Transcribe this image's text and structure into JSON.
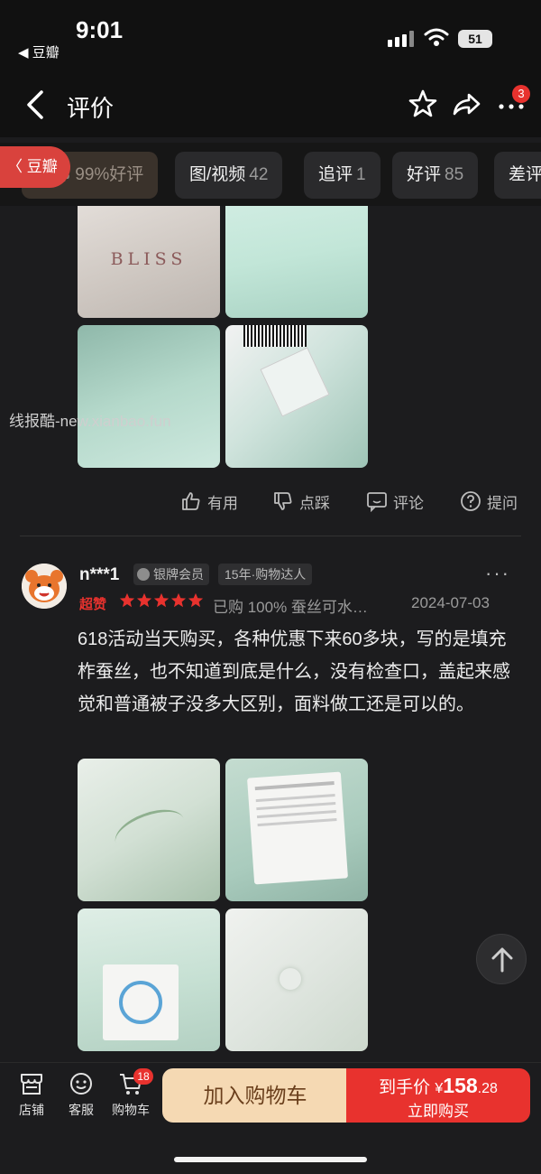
{
  "status": {
    "time": "9:01",
    "back_app": "◀ 豆瓣",
    "battery": "51"
  },
  "navbar": {
    "title": "评价",
    "more_badge": "3"
  },
  "floating_back": "〈 豆瓣",
  "tabs": [
    {
      "label": "全部 99%好评",
      "count": ""
    },
    {
      "label": "图/视频",
      "count": "42"
    },
    {
      "label": "追评",
      "count": "1"
    },
    {
      "label": "好评",
      "count": "85"
    },
    {
      "label": "差评",
      "count": ""
    }
  ],
  "first_review": {
    "image_texts": {
      "bliss": "BLISS"
    },
    "watermark": "线报酷-new.xianbao.fun",
    "actions": {
      "useful": "有用",
      "dislike": "点踩",
      "comment": "评论",
      "ask": "提问"
    }
  },
  "review": {
    "username": "n***1",
    "member": "银牌会员",
    "years": "15年·购物达人",
    "rating_tag": "超赞",
    "stars": 5,
    "bought": "已购 100% 蚕丝可水…",
    "date": "2024-07-03",
    "text": "618活动当天购买，各种优惠下来60多块，写的是填充柞蚕丝，也不知道到底是什么，没有检查口，盖起来感觉和普通被子没多大区别，面料做工还是可以的。"
  },
  "bottom": {
    "shop": "店铺",
    "service": "客服",
    "cart": "购物车",
    "cart_count": "18",
    "add_to_cart": "加入购物车",
    "price_label": "到手价",
    "currency": "¥",
    "price_int": "158",
    "price_dec": ".28",
    "buy_now": "立即购买"
  },
  "colors": {
    "accent": "#e8322e",
    "cart_button": "#f5d9b3",
    "background": "#1c1c1e"
  }
}
